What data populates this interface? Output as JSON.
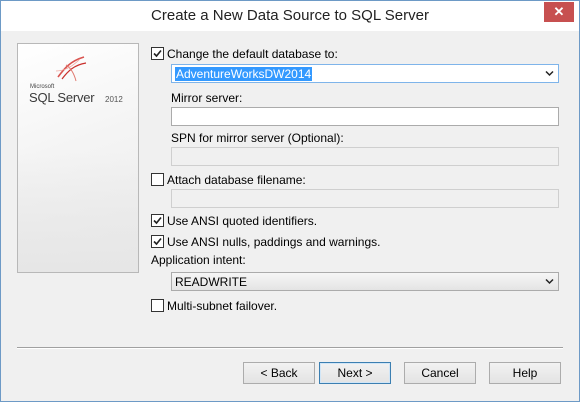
{
  "window": {
    "title": "Create a New Data Source to SQL Server",
    "close_glyph": "✕"
  },
  "logo": {
    "microsoft": "Microsoft",
    "product": "SQL Server",
    "version": "2012"
  },
  "options": {
    "change_db": {
      "label": "Change the default database to:",
      "checked": true
    },
    "database": {
      "value": "AdventureWorksDW2014"
    },
    "mirror_server": {
      "label": "Mirror server:",
      "value": ""
    },
    "spn": {
      "label": "SPN for mirror server (Optional):",
      "value": ""
    },
    "attach": {
      "label": "Attach database filename:",
      "checked": false
    },
    "ansi_quoted": {
      "label": "Use ANSI quoted identifiers.",
      "checked": true
    },
    "ansi_nulls": {
      "label": "Use ANSI nulls, paddings and warnings.",
      "checked": true
    },
    "intent": {
      "label": "Application intent:",
      "value": "READWRITE"
    },
    "multisubnet": {
      "label": "Multi-subnet failover.",
      "checked": false
    }
  },
  "buttons": {
    "back": "< Back",
    "next": "Next >",
    "cancel": "Cancel",
    "help": "Help"
  },
  "colors": {
    "selection": "#3399ff",
    "close": "#c75050",
    "border": "#6d9ac6"
  }
}
